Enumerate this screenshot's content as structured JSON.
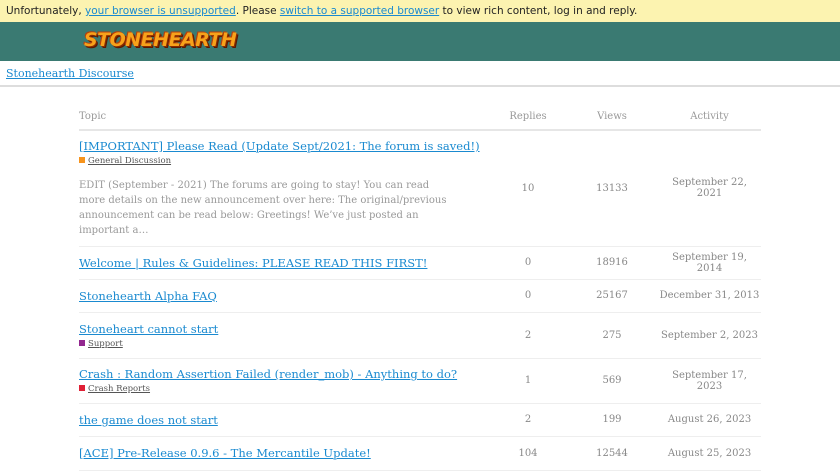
{
  "banner": {
    "pre": "Unfortunately, ",
    "link1": "your browser is unsupported",
    "mid": ". Please ",
    "link2": "switch to a supported browser",
    "post": " to view rich content, log in and reply."
  },
  "logo": "STONEHEARTH",
  "breadcrumb": "Stonehearth Discourse",
  "columns": {
    "topic": "Topic",
    "replies": "Replies",
    "views": "Views",
    "activity": "Activity"
  },
  "topics": [
    {
      "title": "[IMPORTANT] Please Read (Update Sept/2021: The forum is saved!)",
      "category": "General Discussion",
      "color": "#f7941d",
      "excerpt": "EDIT (September - 2021) The forums are going to stay! You can read more details on the new announcement over here: The original/previous announcement can be read below: Greetings! We’ve just posted an important a…",
      "replies": "10",
      "views": "13133",
      "activity": "September 22, 2021"
    },
    {
      "title": "Welcome | Rules & Guidelines: PLEASE READ THIS FIRST!",
      "replies": "0",
      "views": "18916",
      "activity": "September 19, 2014"
    },
    {
      "title": "Stonehearth Alpha FAQ",
      "replies": "0",
      "views": "25167",
      "activity": "December 31, 2013"
    },
    {
      "title": "Stoneheart cannot start",
      "category": "Support",
      "color": "#92278f",
      "replies": "2",
      "views": "275",
      "activity": "September 2, 2023"
    },
    {
      "title": "Crash : Random Assertion Failed (render_mob) - Anything to do?",
      "category": "Crash Reports",
      "color": "#e02035",
      "replies": "1",
      "views": "569",
      "activity": "September 17, 2023"
    },
    {
      "title": "the game does not start",
      "replies": "2",
      "views": "199",
      "activity": "August 26, 2023"
    },
    {
      "title": "[ACE] Pre-Release 0.9.6 - The Mercantile Update!",
      "replies": "104",
      "views": "12544",
      "activity": "August 25, 2023"
    }
  ]
}
